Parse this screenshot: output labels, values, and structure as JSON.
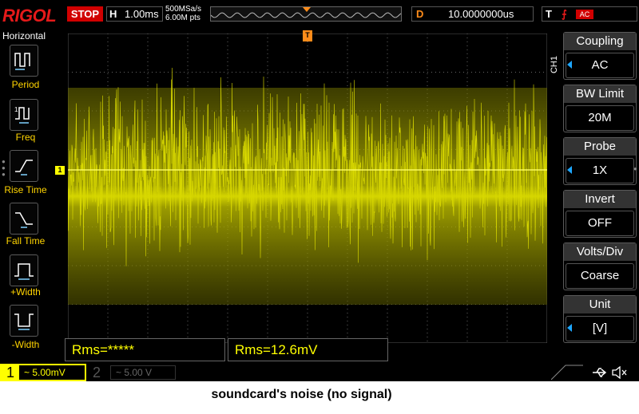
{
  "brand": "RIGOL",
  "topbar": {
    "run_state": "STOP",
    "horizontal_letter": "H",
    "timebase": "1.00ms",
    "sample_rate": "500MSa/s",
    "memory_points": "6.00M pts",
    "delay_letter": "D",
    "delay": "10.0000000us",
    "trigger_letter": "T",
    "trigger_edge_glyph": "⨍",
    "trigger_coupling": "AC"
  },
  "left_menu": {
    "title": "Horizontal",
    "items": [
      {
        "label": "Period",
        "icon": "period-icon"
      },
      {
        "label": "Freq",
        "icon": "frequency-icon"
      },
      {
        "label": "Rise Time",
        "icon": "rise-time-icon"
      },
      {
        "label": "Fall Time",
        "icon": "fall-time-icon"
      },
      {
        "label": "+Width",
        "icon": "positive-width-icon"
      },
      {
        "label": "-Width",
        "icon": "negative-width-icon"
      }
    ]
  },
  "right_menu": {
    "channel_tag": "CH1",
    "items": [
      {
        "title": "Coupling",
        "value": "AC",
        "has_arrow": true
      },
      {
        "title": "BW Limit",
        "value": "20M",
        "has_arrow": false
      },
      {
        "title": "Probe",
        "value": "1X",
        "has_arrow": true
      },
      {
        "title": "Invert",
        "value": "OFF",
        "has_arrow": false
      },
      {
        "title": "Volts/Div",
        "value": "Coarse",
        "has_arrow": false
      },
      {
        "title": "Unit",
        "value": "[V]",
        "has_arrow": true
      }
    ]
  },
  "markers": {
    "channel_marker": "1",
    "trigger_marker": "T"
  },
  "measurements": [
    {
      "text": "Rms=*****"
    },
    {
      "text": "Rms=12.6mV"
    }
  ],
  "channels": [
    {
      "number": "1",
      "scale": "~ 5.00mV",
      "active": true
    },
    {
      "number": "2",
      "scale": "~ 5.00 V",
      "active": false
    }
  ],
  "colors": {
    "ch1": "#ffff00",
    "trace": "#c8c800",
    "trigger": "#ff8c1a",
    "brand": "#e51a1a",
    "accent": "#1ea7ff"
  },
  "caption": "soundcard's noise (no signal)"
}
